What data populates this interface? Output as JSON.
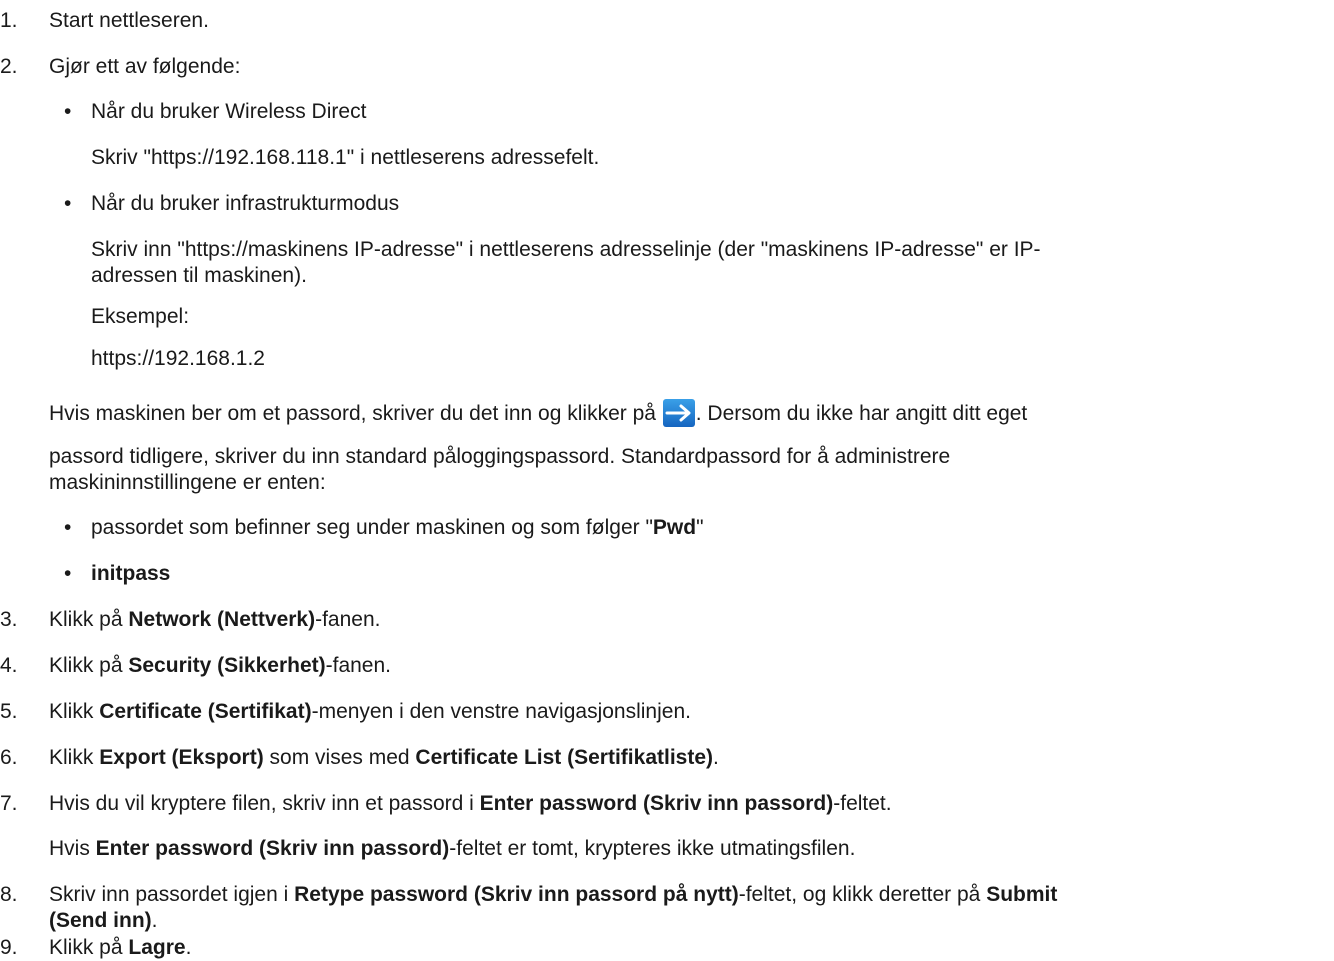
{
  "steps": {
    "s1": {
      "num": "1.",
      "text": "Start nettleseren."
    },
    "s2": {
      "num": "2.",
      "text": "Gjør ett av følgende:",
      "b1_title": "Når du bruker Wireless Direct",
      "b1_body": "Skriv \"https://192.168.118.1\" i nettleserens adressefelt.",
      "b2_title": "Når du bruker infrastrukturmodus",
      "b2_body_l1": "Skriv inn \"https://maskinens IP-adresse\" i nettleserens adresselinje (der \"maskinens IP-adresse\" er IP-",
      "b2_body_l2": "adressen til maskinen).",
      "example_label": "Eksempel:",
      "example_value": "https://192.168.1.2",
      "pwd_l1a": "Hvis maskinen ber om et passord, skriver du det inn og klikker på ",
      "pwd_l1b": ". Dersom du ikke har angitt ditt eget",
      "pwd_l2": "passord tidligere, skriver du inn standard påloggingspassord. Standardpassord for å administrere",
      "pwd_l3": "maskininnstillingene er enten:",
      "opt1_a": "passordet som befinner seg under maskinen og som følger \"",
      "opt1_b": "Pwd",
      "opt1_c": "\"",
      "opt2": "initpass"
    },
    "s3": {
      "num": "3.",
      "a": "Klikk på ",
      "b": "Network (Nettverk)",
      "c": "-fanen."
    },
    "s4": {
      "num": "4.",
      "a": "Klikk på ",
      "b": "Security (Sikkerhet)",
      "c": "-fanen."
    },
    "s5": {
      "num": "5.",
      "a": "Klikk ",
      "b": "Certificate (Sertifikat)",
      "c": "-menyen i den venstre navigasjonslinjen."
    },
    "s6": {
      "num": "6.",
      "a": "Klikk ",
      "b": "Export (Eksport)",
      "c": " som vises med ",
      "d": "Certificate List (Sertifikatliste)",
      "e": "."
    },
    "s7": {
      "num": "7.",
      "a": "Hvis du vil kryptere filen, skriv inn et passord i ",
      "b": "Enter password (Skriv inn passord)",
      "c": "-feltet.",
      "n_a": "Hvis ",
      "n_b": "Enter password (Skriv inn passord)",
      "n_c": "-feltet er tomt, krypteres ikke utmatingsfilen."
    },
    "s8": {
      "num": "8.",
      "a": "Skriv inn passordet igjen i ",
      "b": "Retype password (Skriv inn passord på nytt)",
      "c": "-feltet, og klikk deretter på ",
      "d": "Submit",
      "e": "(Send inn)",
      "f": "."
    },
    "s9": {
      "num": "9.",
      "a": "Klikk på ",
      "b": "Lagre",
      "c": "."
    }
  },
  "bullet_char": "•",
  "colors": {
    "arrow_bg_top": "#3aa0e8",
    "arrow_bg_bottom": "#1565c0",
    "arrow_fg": "#ffffff"
  },
  "icon": "right-arrow-submit-icon"
}
